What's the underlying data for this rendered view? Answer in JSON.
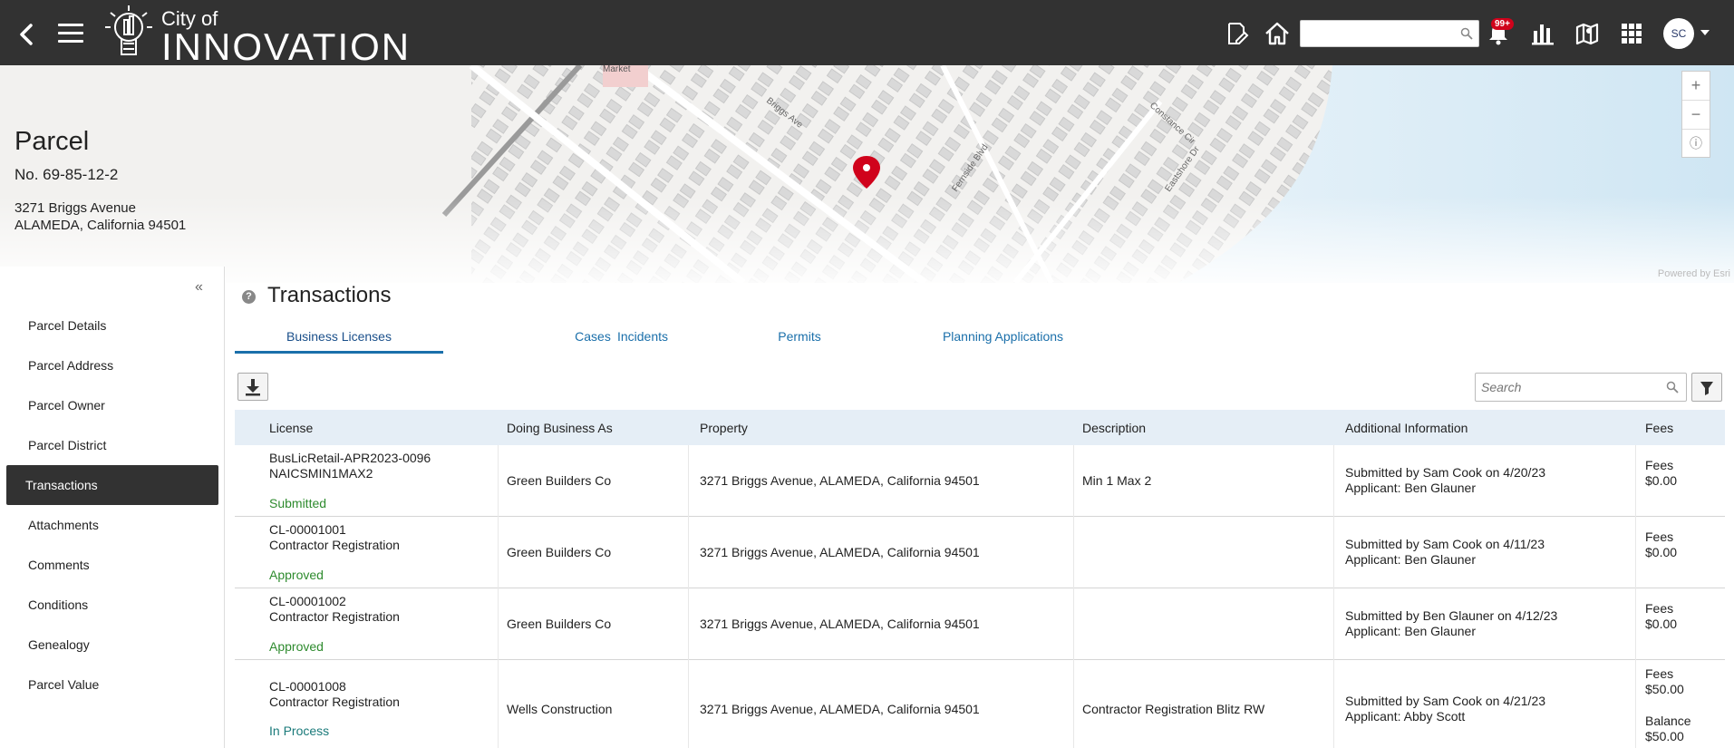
{
  "header": {
    "logo_small": "City of",
    "logo_big": "INNOVATION",
    "search_placeholder": "",
    "notification_badge": "99+",
    "avatar_initials": "SC"
  },
  "parcel": {
    "title": "Parcel",
    "number": "No. 69-85-12-2",
    "address_line1": "3271 Briggs Avenue",
    "address_line2": "ALAMEDA, California 94501"
  },
  "map": {
    "labels": [
      "Market",
      "Briggs Ave",
      "Fernside Blvd",
      "Constance Cir",
      "Eastshore Dr"
    ],
    "powered_by": "Powered by Esri"
  },
  "sidenav": {
    "items": [
      {
        "label": "Parcel Details"
      },
      {
        "label": "Parcel Address"
      },
      {
        "label": "Parcel Owner"
      },
      {
        "label": "Parcel District"
      },
      {
        "label": "Transactions",
        "active": true
      },
      {
        "label": "Attachments"
      },
      {
        "label": "Comments"
      },
      {
        "label": "Conditions"
      },
      {
        "label": "Genealogy"
      },
      {
        "label": "Parcel Value"
      }
    ]
  },
  "main": {
    "title": "Transactions",
    "tabs": [
      {
        "label": "Business Licenses",
        "active": true
      },
      {
        "label": "Cases"
      },
      {
        "label": "Incidents"
      },
      {
        "label": "Permits"
      },
      {
        "label": "Planning Applications"
      }
    ],
    "search_placeholder": "Search",
    "columns": [
      "License",
      "Doing Business As",
      "Property",
      "Description",
      "Additional Information",
      "Fees"
    ],
    "rows": [
      {
        "license_id": "BusLicRetail-APR2023-0096",
        "license_type": "NAICSMIN1MAX2",
        "status": "Submitted",
        "dba": "Green Builders Co",
        "property": "3271 Briggs Avenue, ALAMEDA, California 94501",
        "description": "Min 1 Max 2",
        "info1": "Submitted by Sam Cook on 4/20/23",
        "info2": "Applicant: Ben Glauner",
        "fees_label": "Fees",
        "fees_value": "$0.00"
      },
      {
        "license_id": "CL-00001001",
        "license_type": "Contractor Registration",
        "status": "Approved",
        "dba": "Green Builders Co",
        "property": "3271 Briggs Avenue, ALAMEDA, California 94501",
        "description": "",
        "info1": "Submitted by Sam Cook on 4/11/23",
        "info2": "Applicant: Ben Glauner",
        "fees_label": "Fees",
        "fees_value": "$0.00"
      },
      {
        "license_id": "CL-00001002",
        "license_type": "Contractor Registration",
        "status": "Approved",
        "dba": "Green Builders Co",
        "property": "3271 Briggs Avenue, ALAMEDA, California 94501",
        "description": "",
        "info1": "Submitted by Ben Glauner on 4/12/23",
        "info2": "Applicant: Ben Glauner",
        "fees_label": "Fees",
        "fees_value": "$0.00"
      },
      {
        "license_id": "CL-00001008",
        "license_type": "Contractor Registration",
        "status": "In Process",
        "dba": "Wells Construction",
        "property": "3271 Briggs Avenue, ALAMEDA, California 94501",
        "description": "Contractor Registration Blitz RW",
        "info1": "Submitted by Sam Cook on 4/21/23",
        "info2": "Applicant: Abby Scott",
        "fees_label": "Fees",
        "fees_value": "$50.00",
        "balance_label": "Balance",
        "balance_value": "$50.00"
      }
    ]
  },
  "colors": {
    "header_bg": "#323232",
    "accent_blue": "#1a6faa",
    "status_green": "#2e8b2e",
    "status_teal": "#1a7a7a",
    "table_header_bg": "#e5eef6"
  }
}
